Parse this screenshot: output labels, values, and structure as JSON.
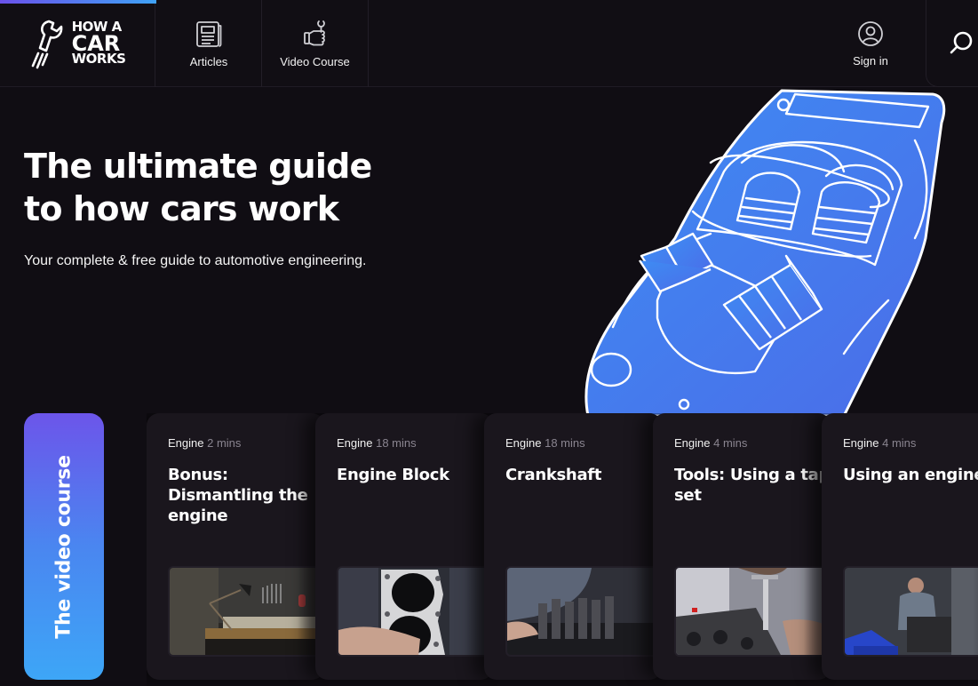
{
  "header": {
    "scroll_progress_percent": 16,
    "logo": {
      "line1": "HOW A",
      "line2": "CAR",
      "line3": "WORKS",
      "icon": "wrench-icon"
    },
    "nav": [
      {
        "label": "Articles",
        "icon": "newspaper-icon"
      },
      {
        "label": "Video Course",
        "icon": "thumbs-up-wrench-icon"
      }
    ],
    "sign_in": {
      "label": "Sign in",
      "icon": "user-circle-icon"
    },
    "search": {
      "icon": "search-icon"
    }
  },
  "hero": {
    "title_line1": "The ultimate guide",
    "title_line2": "to how cars work",
    "subtitle": "Your complete & free guide to automotive engineering.",
    "illustration": "blue-convertible-car-with-books",
    "accent_color": "#4a84f0"
  },
  "video_course": {
    "tab_label": "The video course",
    "gradient": [
      "#6c55ea",
      "#3da6f7"
    ],
    "cards": [
      {
        "category": "Engine",
        "duration": "2 mins",
        "title": "Bonus: Dismantling the engine",
        "thumbnail": "workbench-lamp"
      },
      {
        "category": "Engine",
        "duration": "18 mins",
        "title": "Engine Block",
        "thumbnail": "head-gasket"
      },
      {
        "category": "Engine",
        "duration": "18 mins",
        "title": "Crankshaft",
        "thumbnail": "crankshaft"
      },
      {
        "category": "Engine",
        "duration": "4 mins",
        "title": "Tools: Using a tap set",
        "thumbnail": "tap-set"
      },
      {
        "category": "Engine",
        "duration": "4 mins",
        "title": "Using an engine stand",
        "thumbnail": "engine-stand"
      }
    ]
  }
}
